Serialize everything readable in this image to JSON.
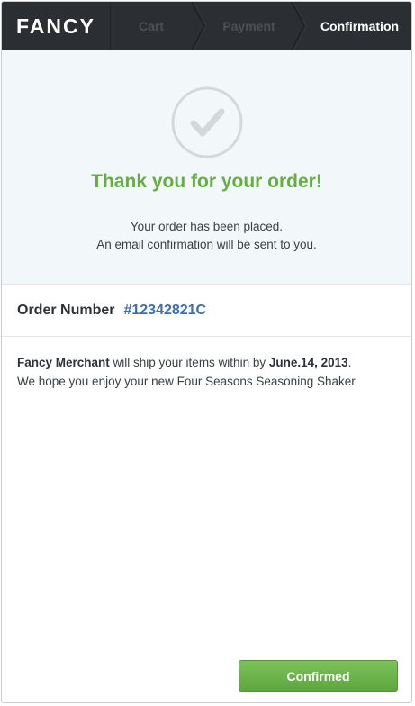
{
  "header": {
    "logo": "FANCY",
    "steps": [
      {
        "label": "Cart",
        "state": "inactive"
      },
      {
        "label": "Payment",
        "state": "inactive"
      },
      {
        "label": "Confirmation",
        "state": "active"
      }
    ]
  },
  "hero": {
    "icon": "checkmark-circle-icon",
    "title": "Thank you for your order!",
    "line1": "Your order has been placed.",
    "line2": "An email confirmation will be sent to you."
  },
  "order": {
    "label": "Order Number",
    "number": "#12342821C"
  },
  "shipping": {
    "merchant": "Fancy Merchant",
    "text1": " will ship your items within by ",
    "date": "June.14, 2013",
    "text1_end": ".",
    "line2": "We hope you enjoy your new Four Seasons Seasoning Shaker"
  },
  "footer": {
    "button_label": "Confirmed"
  },
  "colors": {
    "header_bg": "#2b2f33",
    "hero_bg": "#f2f7f9",
    "accent_green": "#64ae44",
    "order_blue": "#3f6fa3",
    "button_green": "#6bb34a"
  }
}
